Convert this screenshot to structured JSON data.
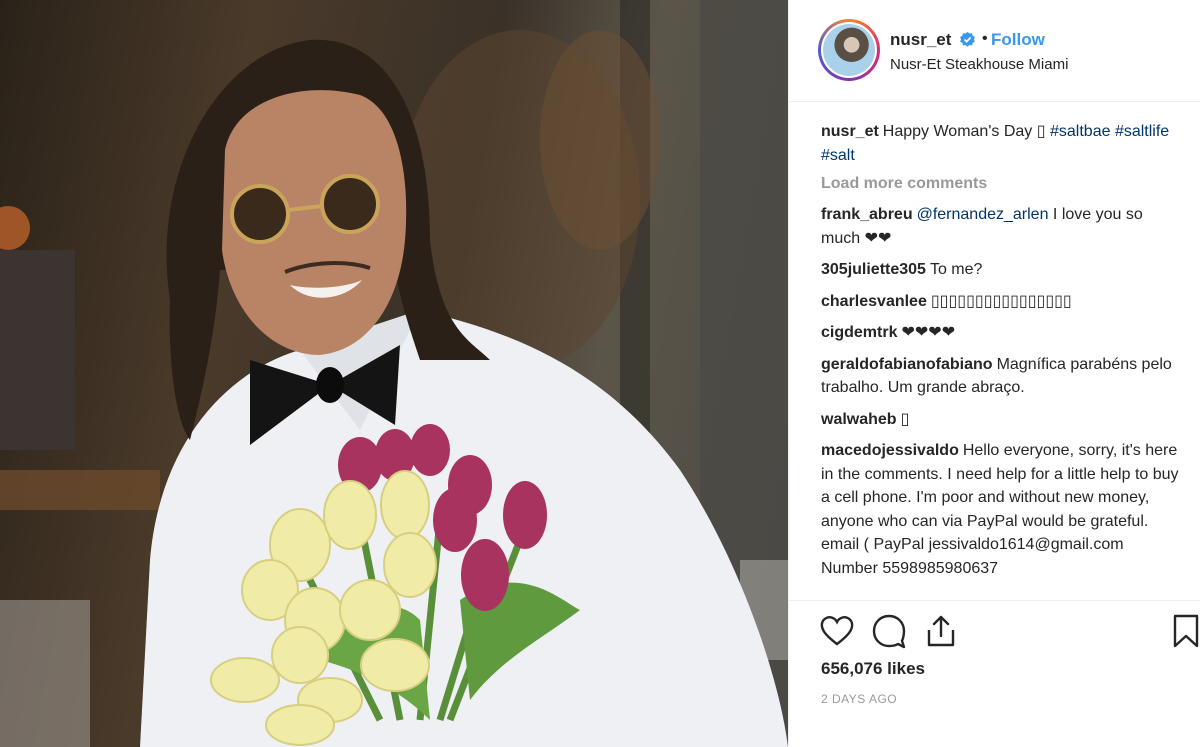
{
  "post": {
    "username": "nusr_et",
    "follow_label": "Follow",
    "dot": "•",
    "location": "Nusr-Et Steakhouse Miami",
    "caption": {
      "username": "nusr_et",
      "text": "Happy Woman's Day ",
      "emoji": "▯",
      "hashtags": [
        "#saltbae",
        "#saltlife",
        "#salt"
      ]
    },
    "load_more": "Load more comments",
    "comments": [
      {
        "user": "frank_abreu",
        "mention": "@fernandez_arlen",
        "text": " I love you so much ❤❤"
      },
      {
        "user": "305juliette305",
        "text": "To me?"
      },
      {
        "user": "charlesvanlee",
        "text": "▯▯▯▯▯▯▯▯▯▯▯▯▯▯▯▯"
      },
      {
        "user": "cigdemtrk",
        "text": "❤❤❤❤"
      },
      {
        "user": "geraldofabianofabiano",
        "text": "Magnífica parabéns pelo trabalho. Um grande abraço."
      },
      {
        "user": "walwaheb",
        "text": "▯"
      },
      {
        "user": "macedojessivaldo",
        "text": "Hello everyone, sorry, it's here in the comments. I need help for a little help to buy a cell phone. I'm poor and without new money, anyone who can via PayPal would be grateful. email ( PayPal jessivaldo1614@gmail.com Number 5598985980637"
      }
    ],
    "likes": "656,076 likes",
    "timestamp": "2 DAYS AGO"
  },
  "icons": {
    "like": "heart-icon",
    "comment": "comment-bubble-icon",
    "share": "share-icon",
    "save": "bookmark-icon",
    "verified": "verified-badge-icon"
  },
  "colors": {
    "link": "#3897f0",
    "hashtag": "#003569",
    "muted": "#999999"
  }
}
